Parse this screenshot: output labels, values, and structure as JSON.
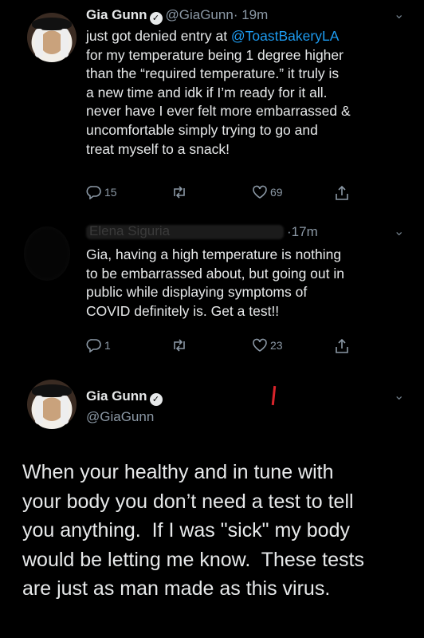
{
  "tweet1": {
    "name": "Gia Gunn",
    "handle": "@GiaGunn",
    "time": "· 19m",
    "lines": [
      "just got denied entry at @ToastBakeryLA",
      "for my temperature being 1 degree higher",
      "than the “required temperature.” it truly is",
      "a new time and idk if I’m ready for it all.",
      "never have I ever felt more embarrassed &",
      "uncomfortable simply trying to go and",
      "treat myself to a snack!"
    ],
    "replies": "15",
    "likes": "69"
  },
  "tweet2": {
    "redacted_name": "Elena Siguria",
    "time": "·17m",
    "lines": [
      "Gia, having a high temperature is nothing",
      "to be embarrassed about, but going out in",
      "public while displaying symptoms of",
      "COVID definitely is. Get a test!!"
    ],
    "replies": "1",
    "likes": "23"
  },
  "tweet3": {
    "name": "Gia Gunn",
    "handle": "@GiaGunn",
    "lines": [
      "When your healthy and in tune with",
      "your body you don’t need a test to tell",
      "you anything.  If I was \"sick\" my body",
      "would be letting me know.  These tests",
      "are just as man made as this virus."
    ]
  },
  "colors": {
    "background": "#000000",
    "text": "#e7e9ea",
    "secondary": "#8b98a5",
    "red_mark": "#d9242b"
  },
  "icons": [
    "reply-icon",
    "retweet-icon",
    "like-icon",
    "share-icon",
    "verified-badge-icon",
    "chevron-down-icon"
  ]
}
